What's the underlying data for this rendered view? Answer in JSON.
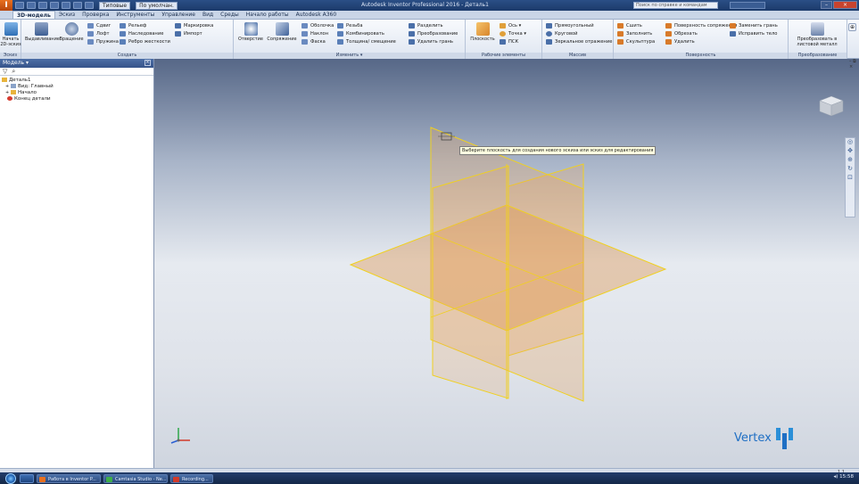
{
  "titlebar": {
    "quick_style": "Типовые",
    "view_style": "По умолчан.",
    "title": "Autodesk Inventor Professional 2016 - Деталь1",
    "help_search": "Поиск по справке и командам"
  },
  "tabs": [
    "3D-модель",
    "Эскиз",
    "Проверка",
    "Инструменты",
    "Управление",
    "Вид",
    "Среды",
    "Начало работы",
    "Autodesk A360"
  ],
  "ribbon": {
    "groups": {
      "sketch": "Эскиз",
      "create": "Создать",
      "modify": "Изменить ▾",
      "work_features": "Рабочие элементы",
      "pattern": "Массив",
      "surface": "Поверхность",
      "convert": "Преобразование"
    },
    "buttons": {
      "start_sketch": "Начать 2D-эскиз",
      "extrude": "Выдавливание",
      "revolve": "Вращение",
      "sweep": "Сдвиг",
      "loft": "Лофт",
      "coil": "Пружина",
      "emboss": "Рельеф",
      "derive": "Наследование",
      "rib": "Ребро жесткости",
      "decal": "Маркировка",
      "import": "Импорт",
      "hole": "Отверстие",
      "fillet": "Сопряжение",
      "shell": "Оболочка",
      "draft": "Наклон",
      "chamfer": "Фаска",
      "thread": "Резьба",
      "combine": "Комбинировать",
      "thicken": "Толщина/ смещение",
      "split": "Разделить",
      "direct": "Преобразование",
      "delete_face": "Удалить грань",
      "plane": "Плоскость",
      "axis": "Ось ▾",
      "point": "Точка ▾",
      "ucs": "ПСК",
      "rect_pattern": "Прямоугольный",
      "circ_pattern": "Круговой",
      "mirror": "Зеркальное отражение",
      "stitch": "Сшить",
      "patch": "Заполнить",
      "sculpt": "Скульптура",
      "extend": "Поверхность сопряжения",
      "trim": "Обрезать",
      "delete": "Удалить",
      "replace_face": "Заменить грань",
      "repair": "Исправить тело",
      "convert_sheet": "Преобразовать в листовой металл"
    }
  },
  "browser": {
    "title": "Модель ▾",
    "close": "×",
    "tree": [
      "Деталь1",
      "Вид: Главный",
      "Начало",
      "Конец детали"
    ]
  },
  "viewport": {
    "tooltip": "Выберите плоскость для создания нового эскиза или эскиз для редактирования",
    "vertex_label": "Vertex"
  },
  "taskbar": {
    "items": [
      "Работа в Inventor P...",
      "Camtasia Studio - Ne...",
      "Recording..."
    ],
    "time": "15:58"
  },
  "status": {
    "right": "1   1"
  },
  "colors": {
    "accent": "#2b4f86",
    "plane_fill": "#e8a660",
    "plane_edge": "#f0d020"
  }
}
